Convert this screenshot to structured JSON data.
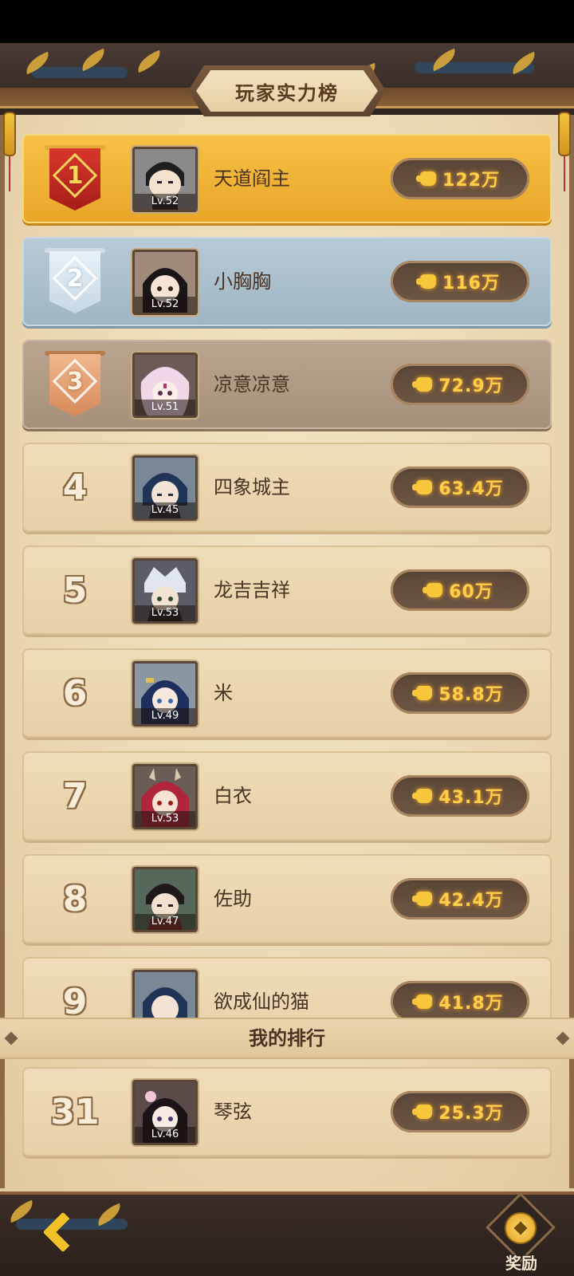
{
  "header": {
    "title": "玩家实力榜"
  },
  "leaderboard": {
    "rows": [
      {
        "rank": "1",
        "name": "天道阎主",
        "level": "Lv.52",
        "power": "122万",
        "avatar": "general-black-helmet-avatar"
      },
      {
        "rank": "2",
        "name": "小胸胸",
        "level": "Lv.52",
        "power": "116万",
        "avatar": "black-hair-girl-avatar"
      },
      {
        "rank": "3",
        "name": "凉意凉意",
        "level": "Lv.51",
        "power": "72.9万",
        "avatar": "white-fox-hair-avatar"
      },
      {
        "rank": "4",
        "name": "四象城主",
        "level": "Lv.45",
        "power": "63.4万",
        "avatar": "blue-hair-hero-avatar"
      },
      {
        "rank": "5",
        "name": "龙吉吉祥",
        "level": "Lv.53",
        "power": "60万",
        "avatar": "silver-crown-hero-avatar"
      },
      {
        "rank": "6",
        "name": "米",
        "level": "Lv.49",
        "power": "58.8万",
        "avatar": "navy-hair-girl-avatar"
      },
      {
        "rank": "7",
        "name": "白衣",
        "level": "Lv.53",
        "power": "43.1万",
        "avatar": "red-hair-horned-avatar"
      },
      {
        "rank": "8",
        "name": "佐助",
        "level": "Lv.47",
        "power": "42.4万",
        "avatar": "dark-hair-scholar-avatar"
      },
      {
        "rank": "9",
        "name": "欲成仙的猫",
        "level": "",
        "power": "41.8万",
        "avatar": "blue-hair-hero-avatar"
      }
    ]
  },
  "my_rank": {
    "title": "我的排行",
    "rank": "31",
    "name": "琴弦",
    "level": "Lv.46",
    "power": "25.3万",
    "avatar": "pale-flower-hair-avatar"
  },
  "footer": {
    "reward_label": "奖励"
  },
  "colors": {
    "gold": "#f6c247",
    "silver": "#b8cad6",
    "bronze": "#b9a590",
    "normal": "#f0dcb9",
    "power_text": "#ffcf4a"
  }
}
